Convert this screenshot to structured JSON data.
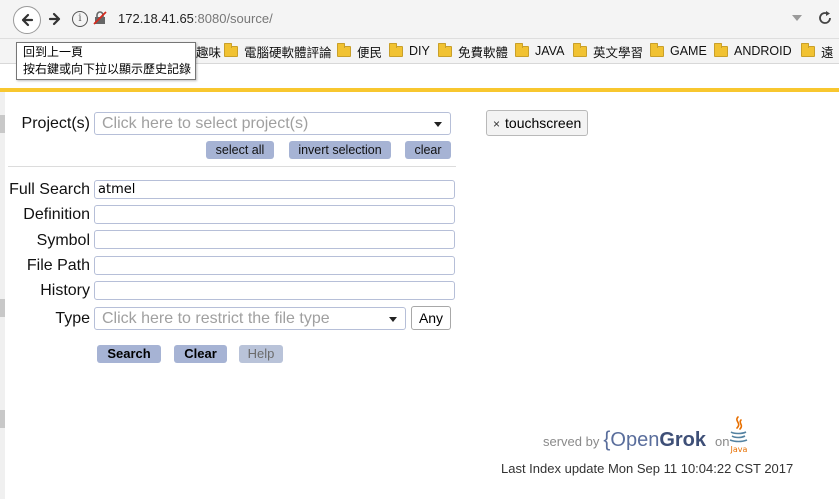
{
  "browser": {
    "url_host": "172.18.41.65",
    "url_rest": ":8080/source/",
    "tooltip_lines": [
      "回到上一頁",
      "按右鍵或向下拉以顯示歷史記錄"
    ]
  },
  "bookmarks": [
    {
      "label": "趣味"
    },
    {
      "label": "電腦硬軟體評論"
    },
    {
      "label": "便民"
    },
    {
      "label": "DIY"
    },
    {
      "label": "免費軟體"
    },
    {
      "label": "JAVA"
    },
    {
      "label": "英文學習"
    },
    {
      "label": "GAME"
    },
    {
      "label": "ANDROID"
    },
    {
      "label": "遠"
    }
  ],
  "form": {
    "project_label": "Project(s)",
    "project_placeholder": "Click here to select project(s)",
    "select_all": "select all",
    "invert_selection": "invert selection",
    "clear_projects": "clear",
    "selected_project_tag": "touchscreen",
    "fields": {
      "full_search": {
        "label": "Full Search",
        "value": "atmel"
      },
      "definition": {
        "label": "Definition",
        "value": ""
      },
      "symbol": {
        "label": "Symbol",
        "value": ""
      },
      "file_path": {
        "label": "File Path",
        "value": ""
      },
      "history": {
        "label": "History",
        "value": ""
      }
    },
    "type_label": "Type",
    "type_placeholder": "Click here to restrict the file type",
    "type_any": "Any",
    "search_button": "Search",
    "clear_button": "Clear",
    "help_button": "Help"
  },
  "footer": {
    "served_by": "served by",
    "brace": "{",
    "brand_open": "Open",
    "brand_grok": "Grok",
    "on": "on",
    "java_text": "Java",
    "last_index": "Last Index update Mon Sep 11 10:04:22 CST 2017"
  },
  "colors": {
    "accent": "#f8c72f",
    "button": "#a6b3d4",
    "brand": "#5a6e9c"
  }
}
